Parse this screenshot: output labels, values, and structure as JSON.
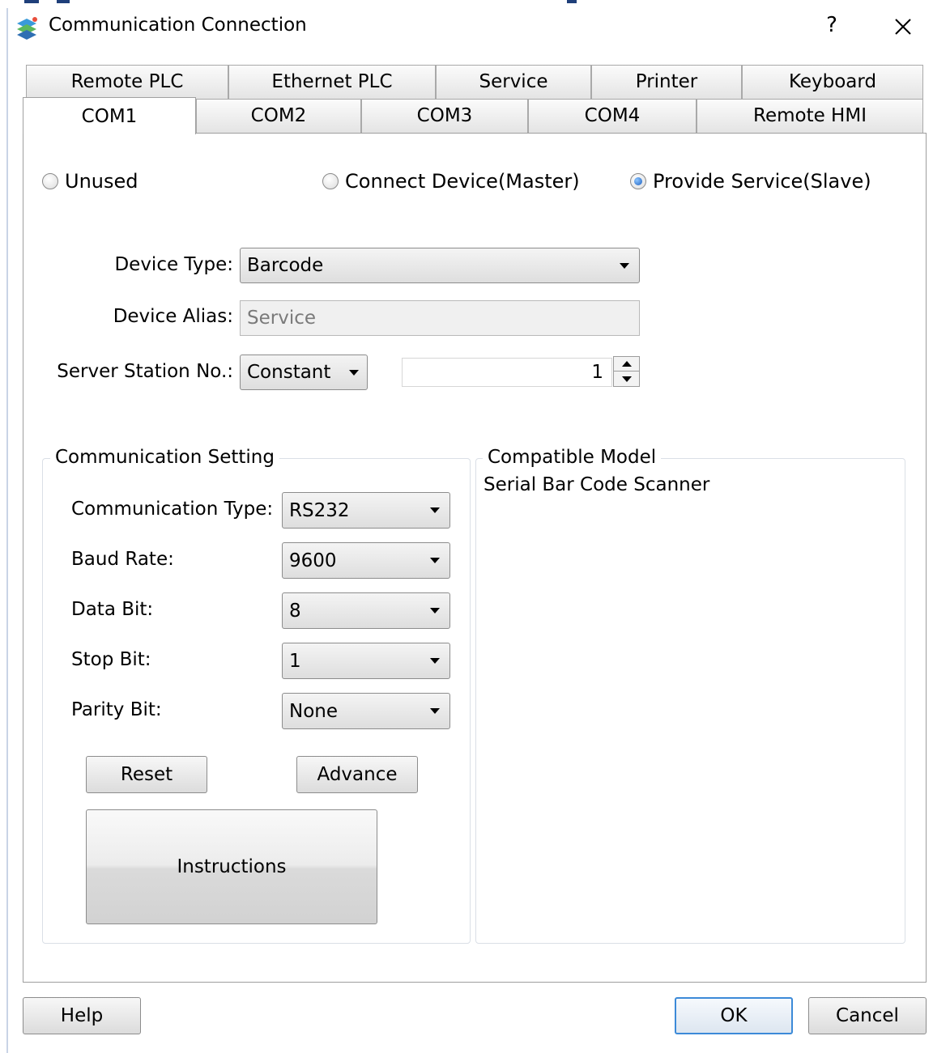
{
  "window": {
    "title": "Communication Connection",
    "help_glyph": "?"
  },
  "tabs_row1": [
    "Remote PLC",
    "Ethernet PLC",
    "Service",
    "Printer",
    "Keyboard"
  ],
  "tabs_row2": [
    "COM1",
    "COM2",
    "COM3",
    "COM4",
    "Remote HMI"
  ],
  "active_tab": "COM1",
  "mode": {
    "options": [
      "Unused",
      "Connect Device(Master)",
      "Provide Service(Slave)"
    ],
    "selected": "Provide Service(Slave)"
  },
  "device": {
    "type_label": "Device Type:",
    "type_value": "Barcode",
    "alias_label": "Device Alias:",
    "alias_placeholder": "Service",
    "station_label": "Server Station No.:",
    "station_mode": "Constant",
    "station_value": "1"
  },
  "comm_setting": {
    "title": "Communication Setting",
    "type_label": "Communication Type:",
    "type_value": "RS232",
    "baud_label": "Baud Rate:",
    "baud_value": "9600",
    "data_bit_label": "Data Bit:",
    "data_bit_value": "8",
    "stop_bit_label": "Stop Bit:",
    "stop_bit_value": "1",
    "parity_label": "Parity Bit:",
    "parity_value": "None",
    "reset_label": "Reset",
    "advance_label": "Advance",
    "instructions_label": "Instructions"
  },
  "compatible": {
    "title": "Compatible Model",
    "model": "Serial Bar Code Scanner"
  },
  "footer": {
    "help_label": "Help",
    "ok_label": "OK",
    "cancel_label": "Cancel"
  },
  "colors": {
    "default_button_border": "#3c8ad8",
    "radio_selected": "#1d5fbf"
  }
}
